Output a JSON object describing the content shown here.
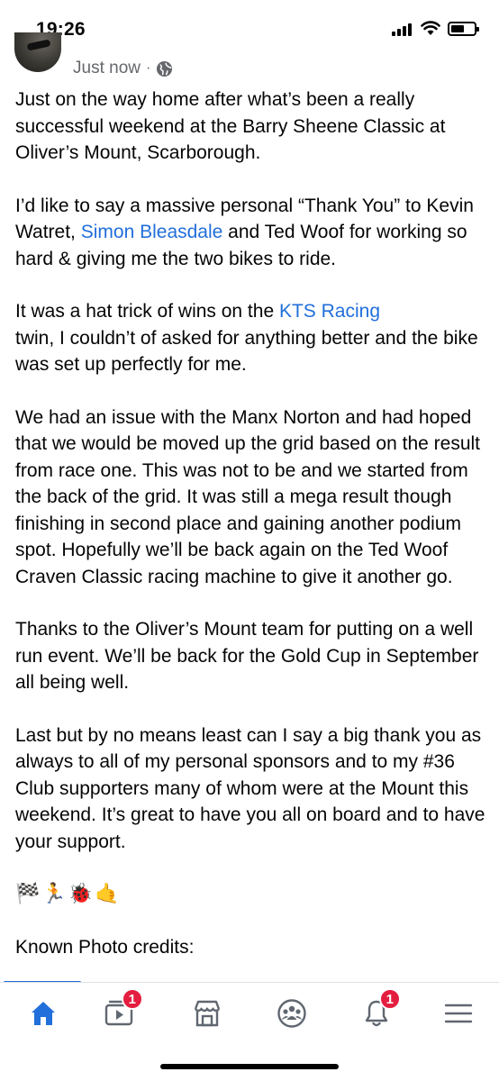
{
  "status_bar": {
    "time": "19:26",
    "icons": [
      "signal-icon",
      "wifi-icon",
      "battery-icon"
    ]
  },
  "post": {
    "timestamp": "Just now",
    "separator": "·",
    "privacy_icon": "globe-icon",
    "paragraphs": [
      {
        "segments": [
          {
            "text": "Just on the way home after what’s been a really successful weekend at the Barry Sheene Classic at Oliver’s Mount, Scarborough."
          }
        ]
      },
      {
        "segments": [
          {
            "text": "I’d like to say a massive personal “Thank You” to Kevin Watret, "
          },
          {
            "text": "Simon Bleasdale",
            "link": true
          },
          {
            "text": " and Ted Woof for working so hard & giving me the two bikes to ride."
          }
        ]
      },
      {
        "segments": [
          {
            "text": "It was a hat trick of wins on the "
          },
          {
            "text": "KTS Racing",
            "link": true
          },
          {
            "text": "\ntwin, I couldn’t of asked for anything better and the bike was set up perfectly for me."
          }
        ]
      },
      {
        "segments": [
          {
            "text": "We had an issue with the Manx Norton and had hoped that we would be moved up the grid based on the result from race one.  This was not to be and we started from the back of the grid.  It was still a mega result though finishing in second place and gaining another podium spot.  Hopefully we’ll be back again on the Ted Woof Craven Classic racing machine to give it another go."
          }
        ]
      },
      {
        "segments": [
          {
            "text": "Thanks to the Oliver’s Mount team for putting on a well run event.  We’ll be back for the Gold Cup in September all being well."
          }
        ]
      },
      {
        "segments": [
          {
            "text": "Last but by no means least can I say a big thank you as always to all of my personal sponsors and to my #36 Club supporters many of whom were at the Mount this weekend.  It’s great to have you all on board and to have your support."
          }
        ]
      }
    ],
    "emojis": [
      "🏁",
      "🏃",
      "🐞",
      "🤙"
    ],
    "credits_line": "Known Photo credits:"
  },
  "bottom_nav": {
    "items": [
      {
        "name": "home",
        "icon": "home-icon",
        "active": true,
        "badge": ""
      },
      {
        "name": "watch",
        "icon": "video-icon",
        "active": false,
        "badge": "1"
      },
      {
        "name": "marketplace",
        "icon": "store-icon",
        "active": false,
        "badge": ""
      },
      {
        "name": "groups",
        "icon": "groups-icon",
        "active": false,
        "badge": ""
      },
      {
        "name": "notifications",
        "icon": "bell-icon",
        "active": false,
        "badge": "1"
      },
      {
        "name": "menu",
        "icon": "menu-icon",
        "active": false,
        "badge": ""
      }
    ]
  },
  "colors": {
    "text": "#050505",
    "secondary_text": "#65676b",
    "link": "#216fdb",
    "badge": "#e41e3f",
    "nav_icon": "#606770"
  }
}
